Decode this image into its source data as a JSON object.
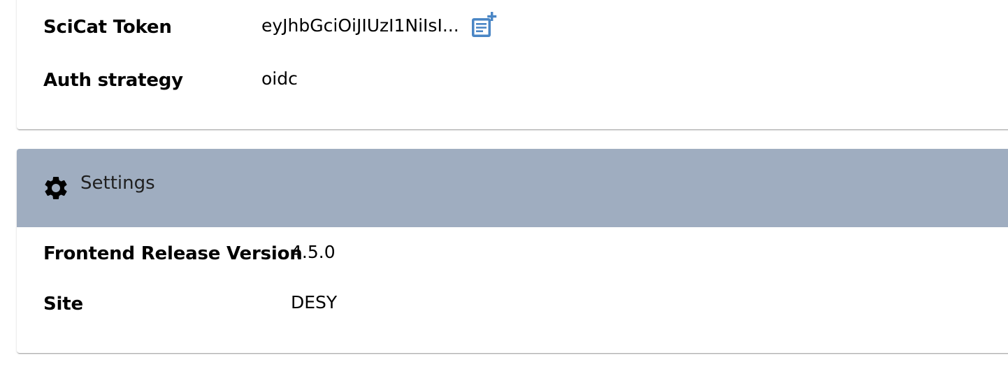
{
  "user_card": {
    "rows": [
      {
        "label": "SciCat Token",
        "value": "eyJhbGciOiJIUzI1NiIsI..."
      },
      {
        "label": "Auth strategy",
        "value": "oidc"
      }
    ],
    "copy_icon": "copy-to-clipboard-icon"
  },
  "settings_card": {
    "title": "Settings",
    "icon": "gear-icon",
    "header_color": "#9fadc0",
    "rows": [
      {
        "label": "Frontend Release Version",
        "value": "4.5.0"
      },
      {
        "label": "Site",
        "value": "DESY"
      }
    ]
  },
  "colors": {
    "accent": "#4a86c5"
  }
}
